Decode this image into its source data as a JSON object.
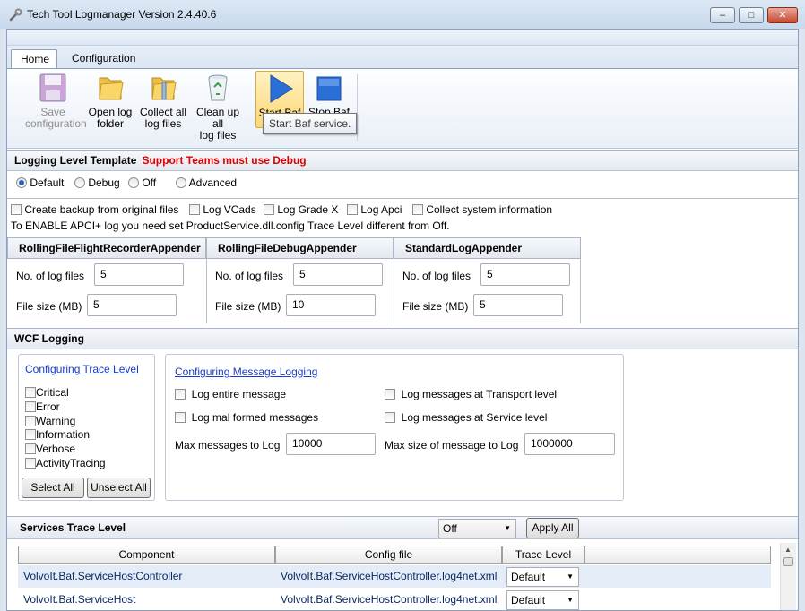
{
  "window": {
    "title": "Tech Tool Logmanager Version 2.4.40.6",
    "min_glyph": "–",
    "max_glyph": "□",
    "close_glyph": "✕"
  },
  "ribbon": {
    "tabs": [
      "Home",
      "Configuration"
    ],
    "buttons": {
      "save": "Save\nconfiguration",
      "open": "Open log\nfolder",
      "collect": "Collect all\nlog files",
      "cleanup": "Clean up all\nlog files",
      "start": "Start Baf",
      "stop": "Stop Baf"
    },
    "tooltip": "Start Baf service."
  },
  "logging_level": {
    "title": "Logging Level Template",
    "warning": "Support Teams must use Debug",
    "options": [
      "Default",
      "Debug",
      "Off",
      "Advanced"
    ],
    "selected": "Default"
  },
  "options": {
    "checks": [
      "Create backup from original files",
      "Log VCads",
      "Log Grade X",
      "Log Apci",
      "Collect system information"
    ],
    "note": "To ENABLE APCI+ log you need set ProductService.dll.config Trace Level different from Off."
  },
  "appenders": [
    {
      "name": "RollingFileFlightRecorderAppender",
      "files_label": "No. of log files",
      "files": "5",
      "size_label": "File size (MB)",
      "size": "5"
    },
    {
      "name": "RollingFileDebugAppender",
      "files_label": "No. of log files",
      "files": "5",
      "size_label": "File size (MB)",
      "size": "10"
    },
    {
      "name": "StandardLogAppender",
      "files_label": "No. of log files",
      "files": "5",
      "size_label": "File size (MB)",
      "size": "5"
    }
  ],
  "wcf": {
    "title": "WCF Logging",
    "trace_link": "Configuring Trace Level",
    "trace_levels": [
      "Critical",
      "Error",
      "Warning",
      "Information",
      "Verbose",
      "ActivityTracing"
    ],
    "select_all": "Select All",
    "unselect_all": "Unselect All",
    "message_link": "Configuring Message Logging",
    "msg_checks": [
      "Log entire message",
      "Log messages at Transport level",
      "Log mal formed messages",
      "Log messages at Service level"
    ],
    "max_messages_label": "Max messages to Log",
    "max_messages": "10000",
    "max_size_label": "Max size of message to Log",
    "max_size": "1000000"
  },
  "services": {
    "title": "Services Trace Level",
    "level": "Off",
    "apply_all": "Apply All",
    "columns": [
      "Component",
      "Config file",
      "Trace Level"
    ],
    "rows": [
      {
        "component": "VolvoIt.Baf.ServiceHostController",
        "config": "VolvoIt.Baf.ServiceHostController.log4net.xml",
        "level": "Default"
      },
      {
        "component": "VolvoIt.Baf.ServiceHost",
        "config": "VolvoIt.Baf.ServiceHostController.log4net.xml",
        "level": "Default"
      }
    ]
  },
  "colors": {
    "accent": "#1a3cc8",
    "warning": "#e00000",
    "selected_row": "#e3ecf7"
  }
}
